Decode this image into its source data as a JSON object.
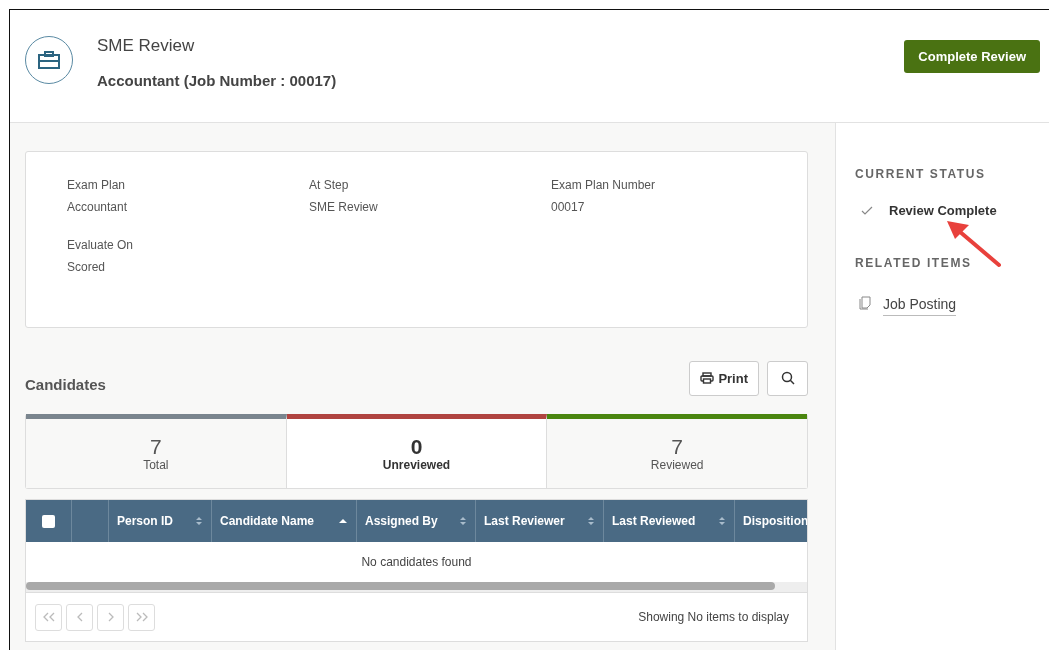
{
  "header": {
    "title": "SME Review",
    "subtitle": "Accountant (Job Number : 00017)",
    "action": "Complete Review"
  },
  "details": [
    {
      "label": "Exam Plan",
      "value": "Accountant"
    },
    {
      "label": "At Step",
      "value": "SME Review"
    },
    {
      "label": "Exam Plan Number",
      "value": "00017"
    },
    {
      "label": "Evaluate On",
      "value": "Scored"
    }
  ],
  "candidates": {
    "title": "Candidates",
    "print": "Print",
    "stats": [
      {
        "count": "7",
        "label": "Total",
        "color": "#7a858e",
        "selected": false
      },
      {
        "count": "0",
        "label": "Unreviewed",
        "color": "#b04440",
        "selected": true
      },
      {
        "count": "7",
        "label": "Reviewed",
        "color": "#4a860f",
        "selected": false
      }
    ],
    "select_all": {
      "checked": false
    },
    "columns": [
      {
        "label": "Person ID",
        "kind": "sortable"
      },
      {
        "label": "Candidate Name",
        "kind": "ascending"
      },
      {
        "label": "Assigned By",
        "kind": "sortable"
      },
      {
        "label": "Last Reviewer",
        "kind": "sortable"
      },
      {
        "label": "Last Reviewed",
        "kind": "sortable"
      },
      {
        "label": "Disposition",
        "kind": "plain"
      }
    ],
    "empty": "No candidates found",
    "pager": {
      "disabled": true,
      "info": "Showing No items to display"
    }
  },
  "sidebar": {
    "status_heading": "CURRENT STATUS",
    "status": "Review Complete",
    "related_heading": "RELATED ITEMS",
    "related": [
      {
        "label": "Job Posting"
      }
    ]
  }
}
